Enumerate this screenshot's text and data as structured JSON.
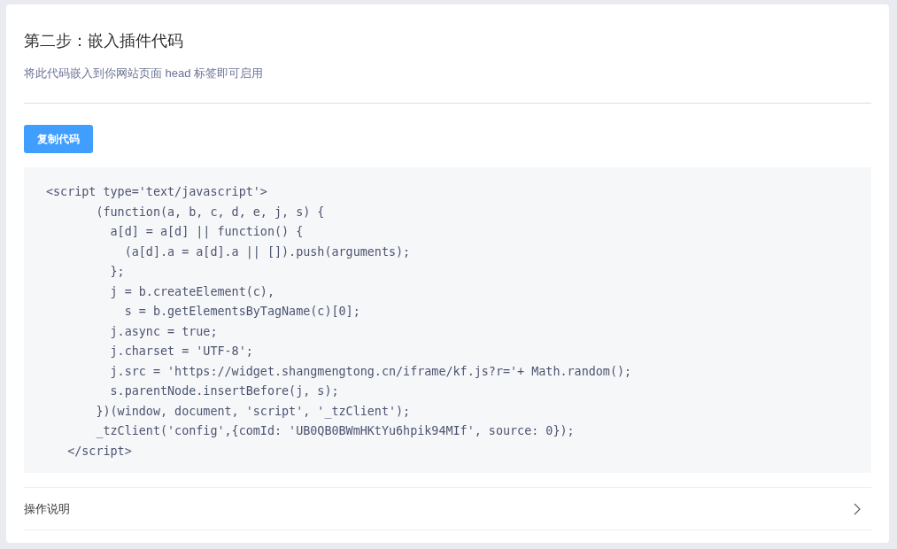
{
  "title": "第二步：嵌入插件代码",
  "subtitle": "将此代码嵌入到你网站页面 head 标签即可启用",
  "copy_button": "复制代码",
  "code": "<script type='text/javascript'>\n       (function(a, b, c, d, e, j, s) {\n         a[d] = a[d] || function() {\n           (a[d].a = a[d].a || []).push(arguments);\n         };\n         j = b.createElement(c),\n           s = b.getElementsByTagName(c)[0];\n         j.async = true;\n         j.charset = 'UTF-8';\n         j.src = 'https://widget.shangmengtong.cn/iframe/kf.js?r='+ Math.random();\n         s.parentNode.insertBefore(j, s);\n       })(window, document, 'script', '_tzClient');\n       _tzClient('config',{comId: 'UB0QB0BWmHKtYu6hpik94MIf', source: 0});\n   </script>",
  "collapse": {
    "label": "操作说明",
    "expanded": false
  }
}
